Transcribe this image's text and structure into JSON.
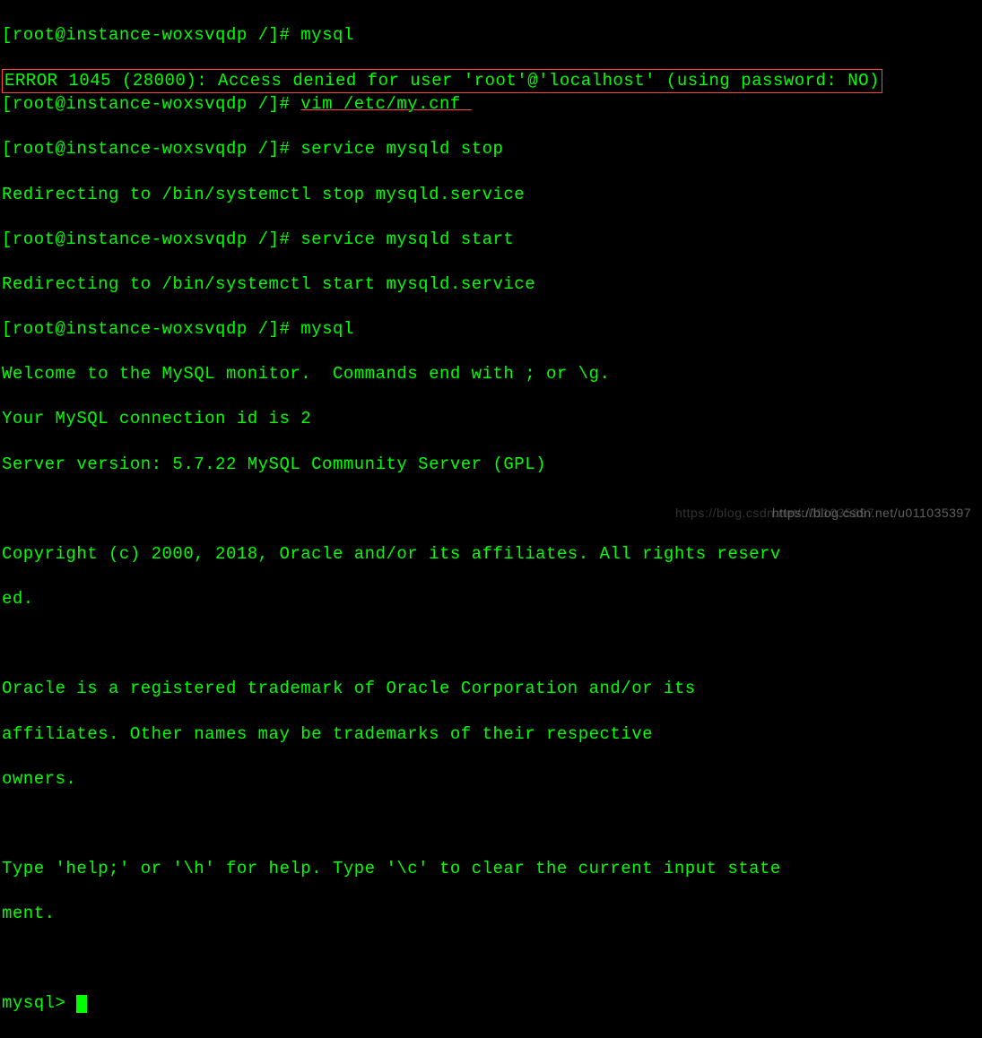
{
  "terminal": {
    "prompt1": "[root@instance-woxsvqdp /]# ",
    "cmd1": "mysql",
    "error_line": "ERROR 1045 (28000): Access denied for user 'root'@'localhost' (using password: NO)",
    "prompt2": "[root@instance-woxsvqdp /]# ",
    "cmd2": "vim /etc/my.cnf ",
    "prompt3": "[root@instance-woxsvqdp /]# ",
    "cmd3": "service mysqld stop",
    "redirect1": "Redirecting to /bin/systemctl stop mysqld.service",
    "prompt4": "[root@instance-woxsvqdp /]# ",
    "cmd4": "service mysqld start",
    "redirect2": "Redirecting to /bin/systemctl start mysqld.service",
    "prompt5": "[root@instance-woxsvqdp /]# ",
    "cmd5": "mysql",
    "welcome1": "Welcome to the MySQL monitor.  Commands end with ; or \\g.",
    "welcome2": "Your MySQL connection id is 2",
    "welcome3": "Server version: 5.7.22 MySQL Community Server (GPL)",
    "blank1": " ",
    "copyright1": "Copyright (c) 2000, 2018, Oracle and/or its affiliates. All rights reserv",
    "copyright2": "ed.",
    "blank2": " ",
    "trademark1": "Oracle is a registered trademark of Oracle Corporation and/or its",
    "trademark2": "affiliates. Other names may be trademarks of their respective",
    "trademark3": "owners.",
    "blank3": " ",
    "help1": "Type 'help;' or '\\h' for help. Type '\\c' to clear the current input state",
    "help2": "ment.",
    "blank4": " ",
    "mysql_prompt": "mysql> "
  },
  "watermark": {
    "text1": "https://blog.csdn.net/u011035397",
    "text2": "https://blog.csdn.net/u011035397"
  }
}
